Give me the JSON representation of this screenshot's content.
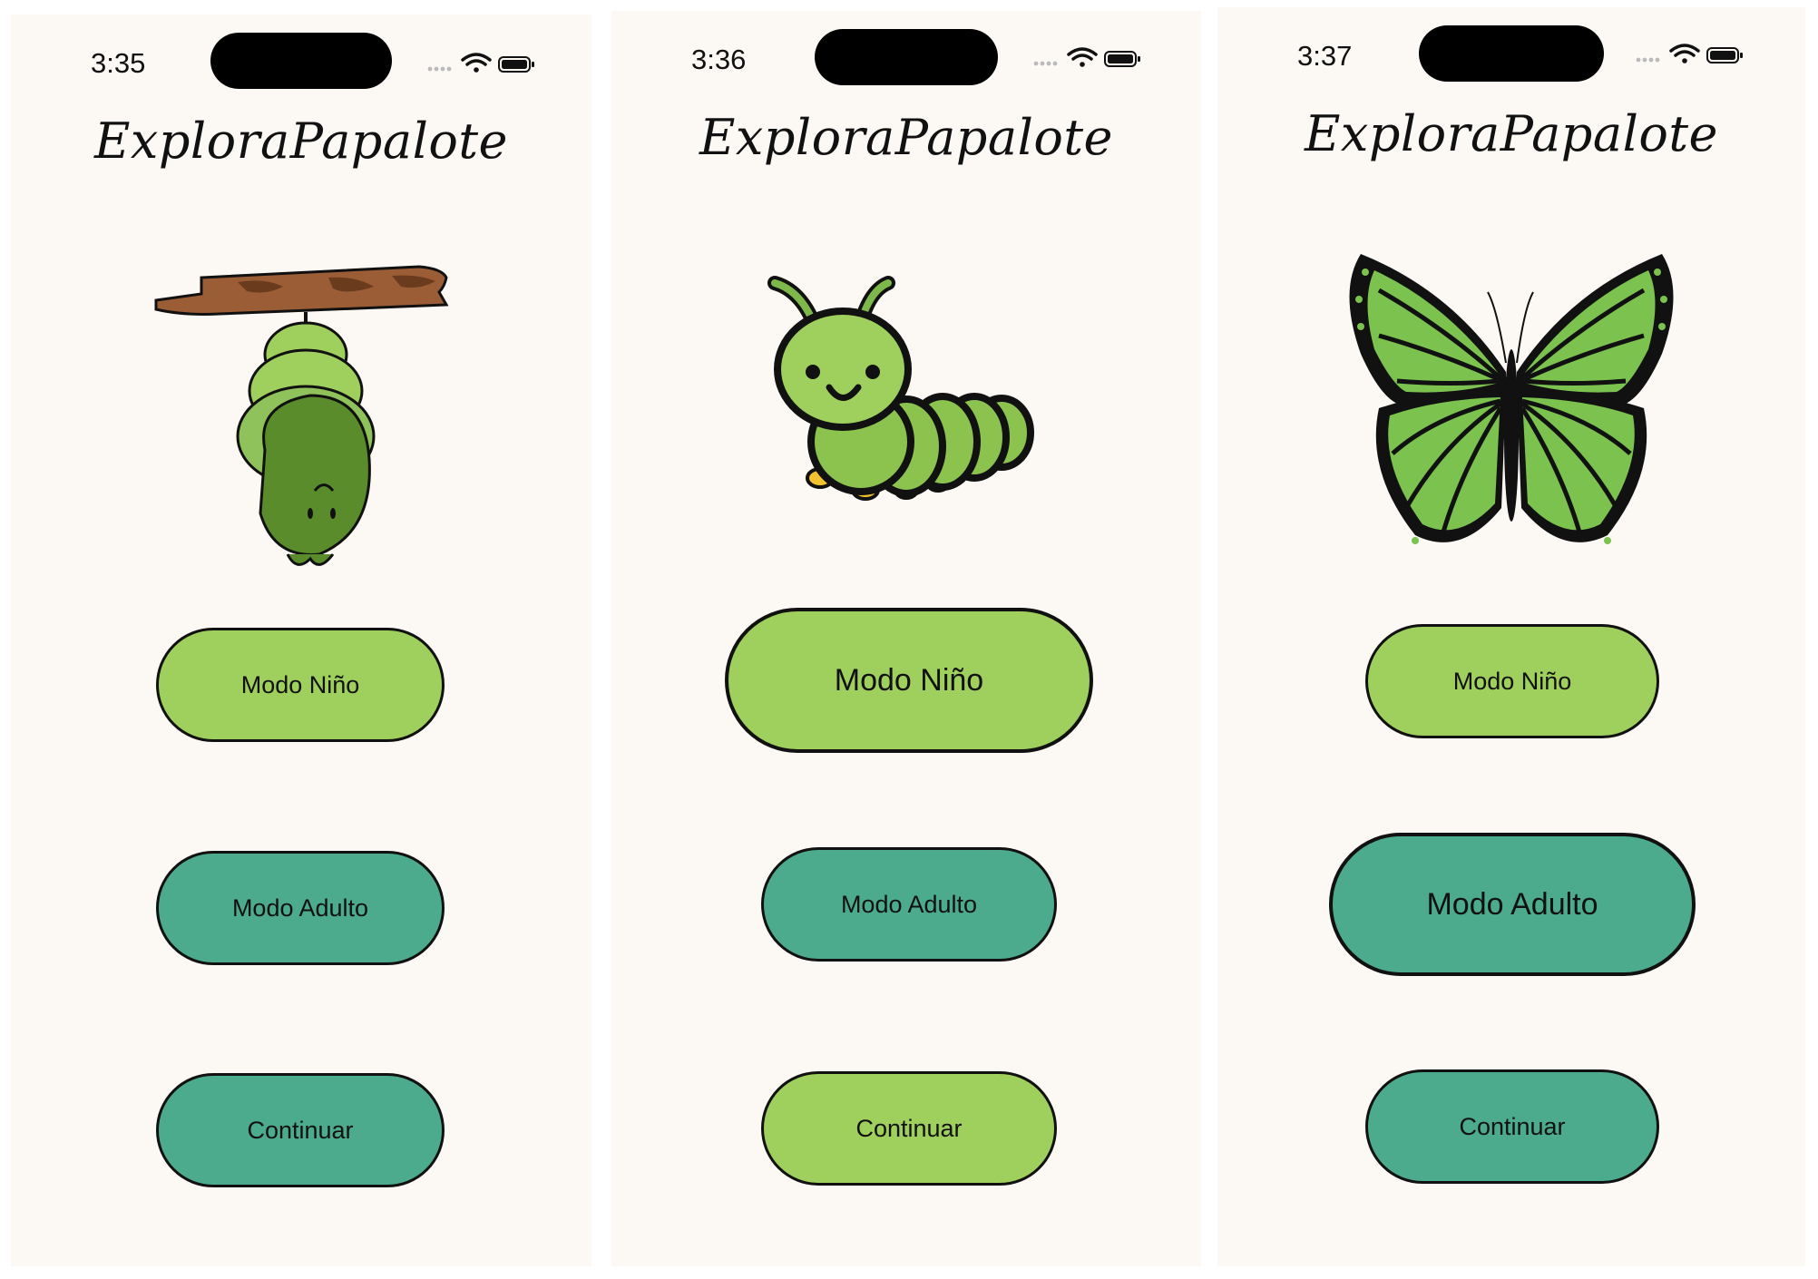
{
  "colors": {
    "background": "#fcf8f3",
    "light_green": "#9fcf5c",
    "teal": "#4cab8c",
    "outline": "#111111"
  },
  "screens": [
    {
      "time": "3:35",
      "title": "ExploraPapalote",
      "illustration": "chrysalis-icon",
      "buttons": [
        {
          "label": "Modo Niño",
          "color": "light_green"
        },
        {
          "label": "Modo Adulto",
          "color": "teal"
        },
        {
          "label": "Continuar",
          "color": "teal"
        }
      ]
    },
    {
      "time": "3:36",
      "title": "ExploraPapalote",
      "illustration": "caterpillar-icon",
      "buttons": [
        {
          "label": "Modo Niño",
          "color": "light_green",
          "emphasized": true
        },
        {
          "label": "Modo Adulto",
          "color": "teal"
        },
        {
          "label": "Continuar",
          "color": "light_green"
        }
      ]
    },
    {
      "time": "3:37",
      "title": "ExploraPapalote",
      "illustration": "butterfly-icon",
      "buttons": [
        {
          "label": "Modo Niño",
          "color": "light_green"
        },
        {
          "label": "Modo Adulto",
          "color": "teal",
          "emphasized": true
        },
        {
          "label": "Continuar",
          "color": "teal"
        }
      ]
    }
  ]
}
